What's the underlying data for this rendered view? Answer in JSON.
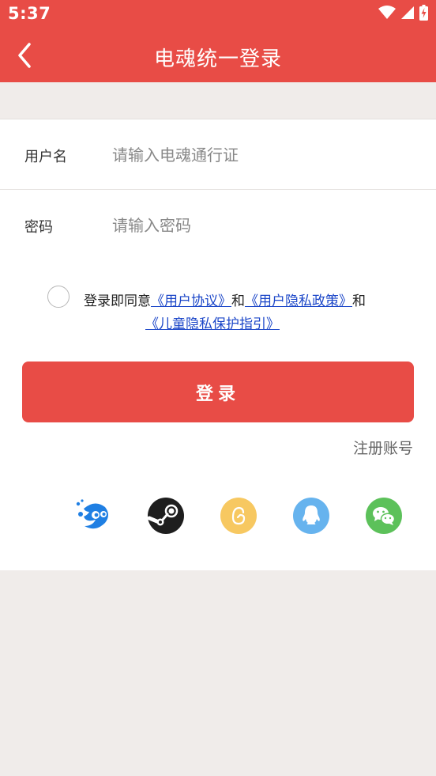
{
  "status_bar": {
    "time": "5:37"
  },
  "header": {
    "title": "电魂统一登录"
  },
  "form": {
    "username_label": "用户名",
    "username_placeholder": "请输入电魂通行证",
    "password_label": "密码",
    "password_placeholder": "请输入密码"
  },
  "agreement": {
    "prefix": "登录即同意",
    "link1": "《用户协议》",
    "and1": "和",
    "link2": "《用户隐私政策》",
    "and2": "和",
    "link3": "《儿童隐私保护指引》"
  },
  "login_button": "登录",
  "register_link": "注册账号",
  "social": [
    {
      "name": "dianhun",
      "color": "#1f7fe3"
    },
    {
      "name": "steam",
      "color": "#1e1e1e"
    },
    {
      "name": "egg",
      "color": "#f7c861"
    },
    {
      "name": "qq",
      "color": "#66b3ee"
    },
    {
      "name": "wechat",
      "color": "#5cc15a"
    }
  ]
}
